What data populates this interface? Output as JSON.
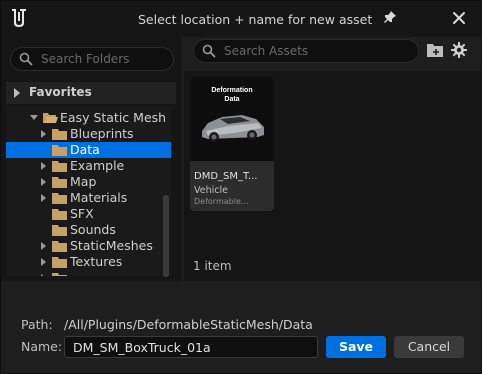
{
  "window": {
    "title": "Select location + name for new asset"
  },
  "left_panel": {
    "search_placeholder": "Search Folders",
    "favorites_label": "Favorites",
    "tree": [
      {
        "label": "Easy Static Mesh",
        "expanded": true,
        "selected": false
      },
      {
        "label": "Blueprints",
        "expanded": false,
        "selected": false
      },
      {
        "label": "Data",
        "expanded": false,
        "selected": true
      },
      {
        "label": "Example",
        "expanded": false,
        "selected": false
      },
      {
        "label": "Map",
        "expanded": false,
        "selected": false
      },
      {
        "label": "Materials",
        "expanded": false,
        "selected": false
      },
      {
        "label": "SFX",
        "expanded": false,
        "selected": false
      },
      {
        "label": "Sounds",
        "expanded": false,
        "selected": false
      },
      {
        "label": "StaticMeshes",
        "expanded": false,
        "selected": false
      },
      {
        "label": "Textures",
        "expanded": false,
        "selected": false
      }
    ]
  },
  "right_panel": {
    "search_placeholder": "Search Assets",
    "asset": {
      "thumb_title": "Deformation Data",
      "name": "DMD_SM_T...",
      "kind": "Vehicle",
      "subtype": "Deformable..."
    },
    "item_count": "1 item"
  },
  "bottom": {
    "path_label": "Path:",
    "path_value": "/All/Plugins/DeformableStaticMesh/Data",
    "name_label": "Name:",
    "name_value": "DM_SM_BoxTruck_01a",
    "save_label": "Save",
    "cancel_label": "Cancel"
  },
  "colors": {
    "accent": "#0070e0",
    "background": "#1e1e1e"
  }
}
